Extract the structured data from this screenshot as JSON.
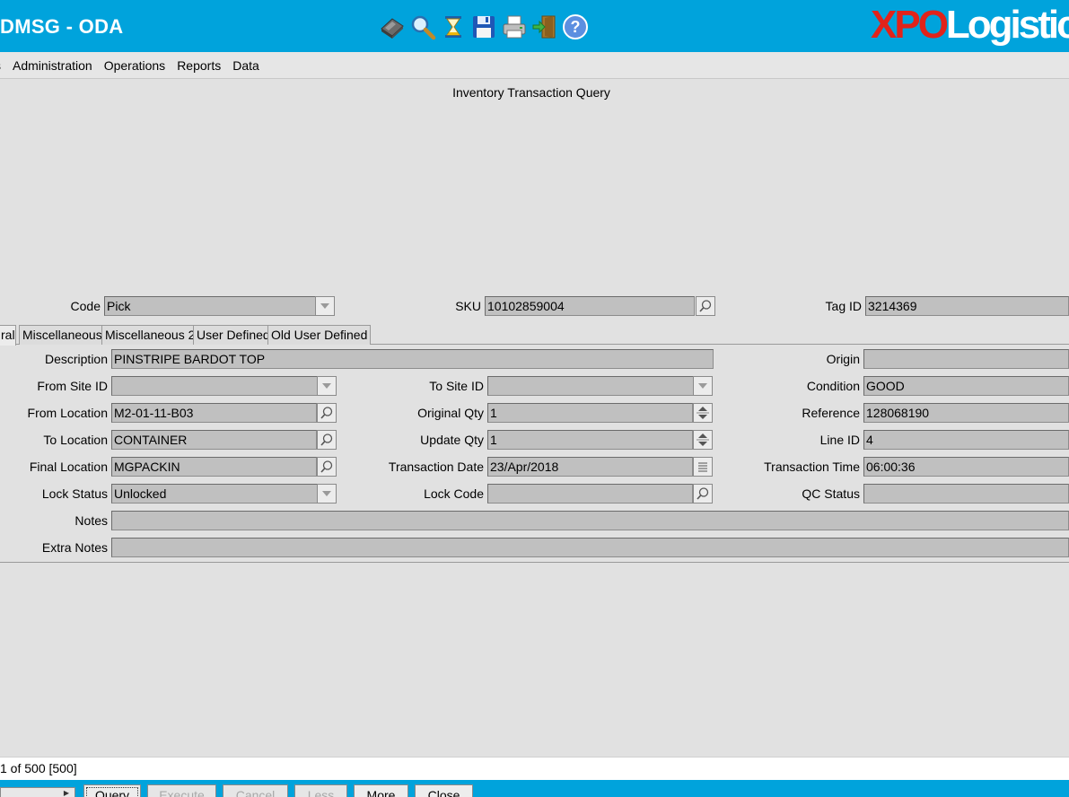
{
  "header": {
    "app_title": "DMSG - ODA",
    "logo_part1": "XPO",
    "logo_part2": "Logistic",
    "toolbar_icons": [
      "eraser-icon",
      "search-icon",
      "hourglass-icon",
      "save-icon",
      "print-icon",
      "exit-icon",
      "help-icon"
    ]
  },
  "menu": [
    "s",
    "Administration",
    "Operations",
    "Reports",
    "Data"
  ],
  "form_title": "Inventory Transaction Query",
  "top_fields": {
    "code_label": "Code",
    "code_value": "Pick",
    "sku_label": "SKU",
    "sku_value": "10102859004",
    "tag_label": "Tag ID",
    "tag_value": "3214369"
  },
  "tabs": [
    "ral",
    "Miscellaneous",
    "Miscellaneous 2",
    "User Defined",
    "Old User Defined"
  ],
  "fields": {
    "description_label": "Description",
    "description_value": "PINSTRIPE BARDOT TOP",
    "origin_label": "Origin",
    "origin_value": "",
    "from_site_label": "From Site ID",
    "from_site_value": "",
    "to_site_label": "To Site ID",
    "to_site_value": "",
    "condition_label": "Condition",
    "condition_value": "GOOD",
    "from_location_label": "From Location",
    "from_location_value": "M2-01-11-B03",
    "original_qty_label": "Original Qty",
    "original_qty_value": "1",
    "reference_label": "Reference",
    "reference_value": "128068190",
    "to_location_label": "To Location",
    "to_location_value": "CONTAINER",
    "update_qty_label": "Update Qty",
    "update_qty_value": "1",
    "line_id_label": "Line ID",
    "line_id_value": "4",
    "final_location_label": "Final Location",
    "final_location_value": "MGPACKIN",
    "transaction_date_label": "Transaction Date",
    "transaction_date_value": "23/Apr/2018",
    "transaction_time_label": "Transaction Time",
    "transaction_time_value": "06:00:36",
    "lock_status_label": "Lock Status",
    "lock_status_value": "Unlocked",
    "lock_code_label": "Lock Code",
    "lock_code_value": "",
    "qc_status_label": "QC Status",
    "qc_status_value": "",
    "notes_label": "Notes",
    "notes_value": "",
    "extra_notes_label": "Extra Notes",
    "extra_notes_value": ""
  },
  "status": {
    "record_count": "1 of 500 [500]"
  },
  "buttons": {
    "query": "Query",
    "execute": "Execute",
    "cancel": "Cancel",
    "less": "Less",
    "more": "More",
    "close": "Close"
  },
  "colors": {
    "header_bg": "#00a3dc",
    "logo_red": "#e2231a",
    "field_bg": "#c0c0c0"
  }
}
